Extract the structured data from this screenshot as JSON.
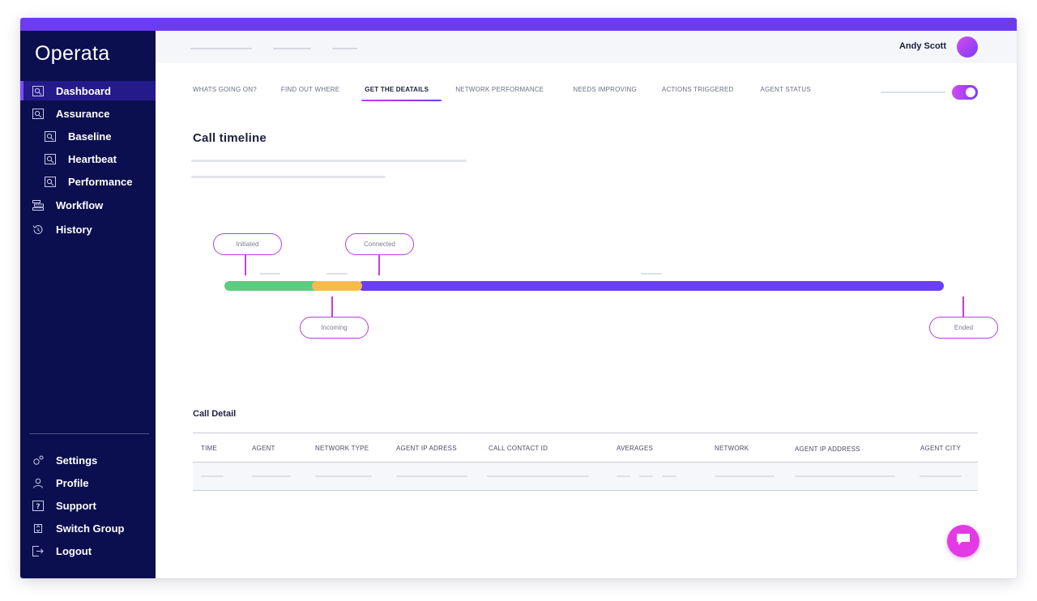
{
  "app": {
    "name": "Operata"
  },
  "colors": {
    "accent": "#6c3cf0",
    "sidebar_bg": "#0b0f4f",
    "magenta": "#d24bf0",
    "green": "#5ccc80",
    "orange": "#f7bb4d"
  },
  "sidebar": {
    "items": [
      {
        "label": "Dashboard",
        "icon": "dashboard-icon"
      },
      {
        "label": "Assurance",
        "icon": "assurance-icon"
      },
      {
        "label": "Baseline",
        "icon": "baseline-icon"
      },
      {
        "label": "Heartbeat",
        "icon": "heartbeat-icon"
      },
      {
        "label": "Performance",
        "icon": "performance-icon"
      },
      {
        "label": "Workflow",
        "icon": "workflow-icon"
      },
      {
        "label": "History",
        "icon": "history-icon"
      }
    ],
    "bottom_items": [
      {
        "label": "Settings",
        "icon": "settings-icon"
      },
      {
        "label": "Profile",
        "icon": "profile-icon"
      },
      {
        "label": "Support",
        "icon": "support-icon"
      },
      {
        "label": "Switch Group",
        "icon": "switch-group-icon"
      },
      {
        "label": "Logout",
        "icon": "logout-icon"
      }
    ]
  },
  "header": {
    "user_name": "Andy Scott"
  },
  "tabs": [
    "WHATS GOING ON?",
    "FIND OUT WHERE",
    "GET THE DEATAILS",
    "NETWORK PERFORMANCE",
    "NEEDS IMPROVING",
    "ACTIONS TRIGGERED",
    "AGENT STATUS"
  ],
  "active_tab": "GET THE DEATAILS",
  "timeline": {
    "title": "Call timeline",
    "events": {
      "initiated": "Initiated",
      "connected": "Connected",
      "incoming": "Incoming",
      "ended": "Ended"
    }
  },
  "call_detail": {
    "title": "Call Detail",
    "columns": [
      "TIME",
      "AGENT",
      "NETWORK TYPE",
      "AGENT IP ADRESS",
      "CALL CONTACT ID",
      "AVERAGES",
      "NETWORK",
      "AGENT IP ADDRESS",
      "AGENT CITY"
    ]
  }
}
